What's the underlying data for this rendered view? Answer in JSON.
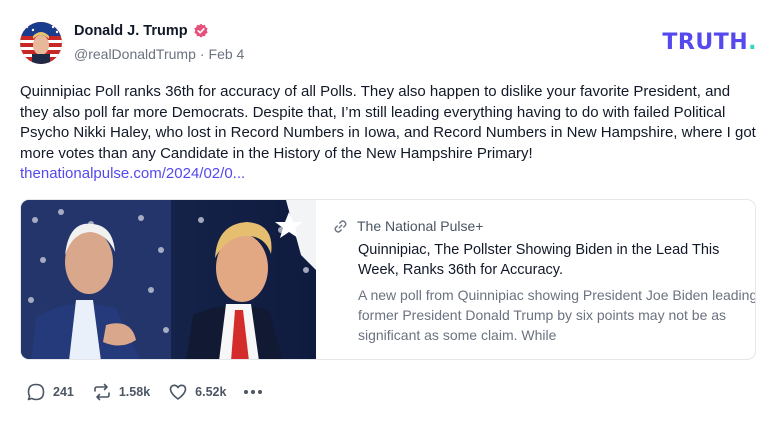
{
  "author": {
    "display_name": "Donald J. Trump",
    "handle": "@realDonaldTrump",
    "separator": "·",
    "date": "Feb 4",
    "avatar_icon": "profile-avatar-flag",
    "verified_icon": "verified-badge-icon"
  },
  "brand": {
    "logo_text": "TRUTH",
    "logo_dot": ".",
    "logo_color": "#5448ee",
    "dot_color": "#38d4c4"
  },
  "post": {
    "text": "Quinnipiac Poll ranks 36th for accuracy of all Polls. They also happen to dislike your favorite President, and they also poll far more Democrats. Despite that, I’m still leading everything having to do with failed Political Psycho Nikki Haley, who lost in Record Numbers in Iowa, and Record Numbers in New Hampshire, where I got more votes than any Candidate in the History of the New Hampshire Primary!",
    "link": "thenationalpulse.com/2024/02/0...",
    "link_color": "#5448ee"
  },
  "link_card": {
    "source": "The National Pulse+",
    "title": "Quinnipiac, The Pollster Showing Biden in the Lead This Week, Ranks 36th for Accuracy.",
    "description": "A new poll from Quinnipiac showing President Joe Biden leading former President Donald Trump by six points may not be as significant as some claim. While",
    "image_icon": "biden-trump-photo",
    "source_icon": "link-icon"
  },
  "actions": {
    "replies": "241",
    "retruths": "1.58k",
    "likes": "6.52k",
    "reply_icon": "reply-icon",
    "retruth_icon": "retruth-icon",
    "like_icon": "heart-icon",
    "more_icon": "more-icon"
  }
}
